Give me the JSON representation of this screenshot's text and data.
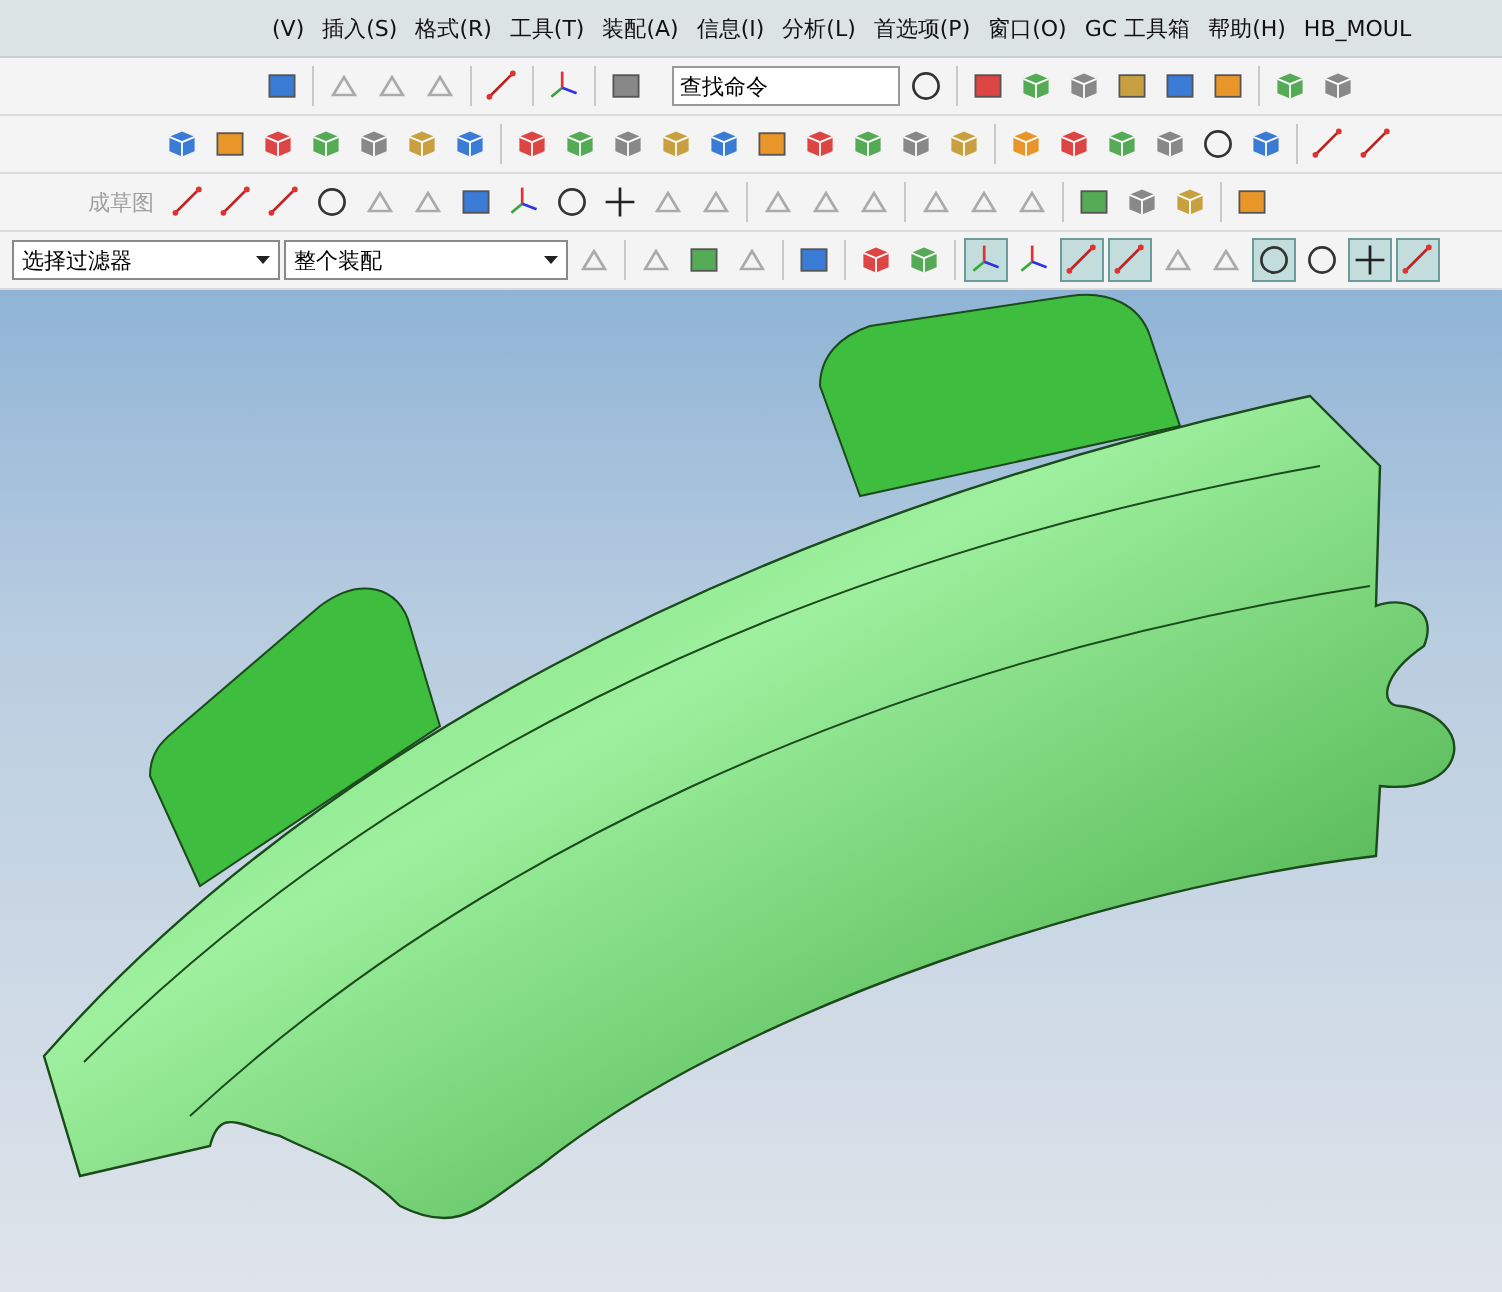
{
  "menu_bar": {
    "items": [
      "(V)",
      "插入(S)",
      "格式(R)",
      "工具(T)",
      "装配(A)",
      "信息(I)",
      "分析(L)",
      "首选项(P)",
      "窗口(O)",
      "GC 工具箱",
      "帮助(H)",
      "HB_MOUL"
    ]
  },
  "search": {
    "value": "查找命令"
  },
  "sketch_toolbar": {
    "finish_label": "成草图",
    "disabled": true
  },
  "selection_bar": {
    "filter": "选择过滤器",
    "scope": "整个装配"
  },
  "snap_buttons": [
    {
      "selected": true
    },
    {
      "selected": false
    },
    {
      "selected": true
    },
    {
      "selected": true
    },
    {
      "selected": false
    },
    {
      "selected": false
    },
    {
      "selected": true
    },
    {
      "selected": false
    },
    {
      "selected": true
    },
    {
      "selected": true
    }
  ]
}
